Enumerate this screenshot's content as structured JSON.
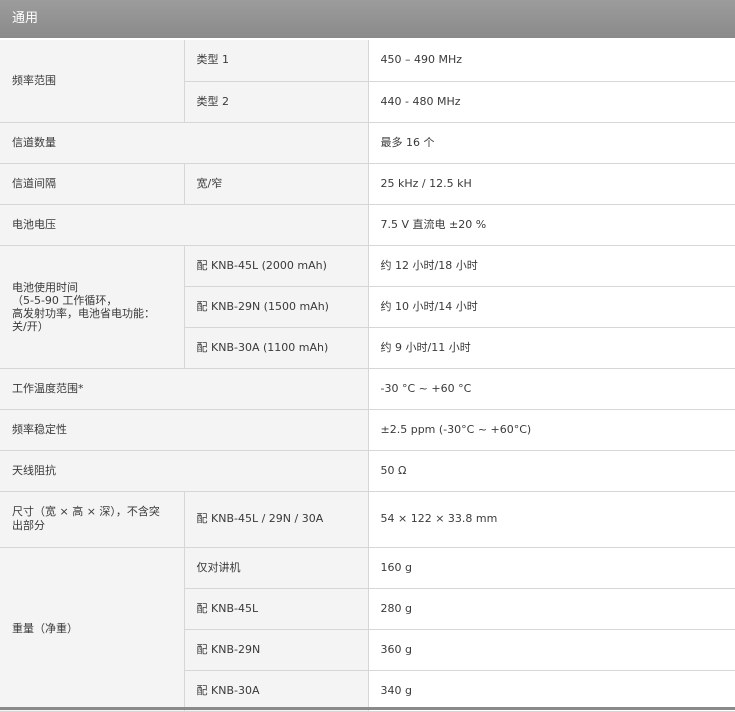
{
  "section_title": "通用",
  "rows": {
    "freq_range": {
      "label": "频率范围",
      "type1": "类型 1",
      "type1_value": "450 – 490 MHz",
      "type2": "类型 2",
      "type2_value": "440 - 480 MHz"
    },
    "channels": {
      "label": "信道数量",
      "value": "最多 16 个"
    },
    "spacing": {
      "label": "信道间隔",
      "sub": "宽/窄",
      "value": "25 kHz / 12.5 kH"
    },
    "voltage": {
      "label": "电池电压",
      "value": "7.5 V 直流电 ±20 %"
    },
    "battery": {
      "label_lines": [
        "电池使用时间",
        "（5-5-90 工作循环，",
        "高发射功率，电池省电功能：",
        "关/开）"
      ],
      "items": [
        {
          "name": "配 KNB-45L (2000 mAh)",
          "value": "约 12 小时/18 小时"
        },
        {
          "name": "配 KNB-29N (1500 mAh)",
          "value": "约 10 小时/14 小时"
        },
        {
          "name": "配 KNB-30A (1100 mAh)",
          "value": "约 9 小时/11 小时"
        }
      ]
    },
    "temp": {
      "label": "工作温度范围*",
      "value": "-30 °C ~ +60 °C"
    },
    "stability": {
      "label": "频率稳定性",
      "value": "±2.5 ppm (-30°C ~ +60°C)"
    },
    "impedance": {
      "label": "天线阻抗",
      "value": "50 Ω"
    },
    "dimensions": {
      "label_lines": [
        "尺寸（宽 × 高 × 深），不含突",
        "出部分"
      ],
      "sub": "配 KNB-45L / 29N / 30A",
      "value": "54 × 122 × 33.8 mm"
    },
    "weight": {
      "label": "重量（净重）",
      "items": [
        {
          "name": "仅对讲机",
          "value": "160 g"
        },
        {
          "name": "配 KNB-45L",
          "value": "280 g"
        },
        {
          "name": "配 KNB-29N",
          "value": "360 g"
        },
        {
          "name": "配 KNB-30A",
          "value": "340 g"
        }
      ]
    }
  }
}
